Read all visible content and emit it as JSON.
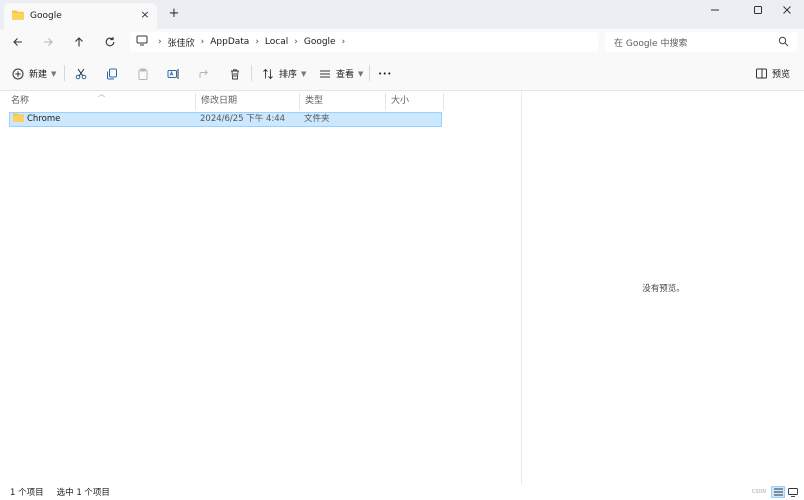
{
  "window": {
    "tab_title": "Google",
    "close_tab_glyph": "×",
    "new_tab_glyph": "+"
  },
  "navigation": {
    "breadcrumbs": [
      "张佳欣",
      "AppData",
      "Local",
      "Google"
    ],
    "separator": "›",
    "search_placeholder": "在 Google 中搜索"
  },
  "toolbar": {
    "new_label": "新建",
    "sort_label": "排序",
    "view_label": "查看",
    "more_glyph": "•••",
    "preview_label": "预览"
  },
  "columns": {
    "name": "名称",
    "date": "修改日期",
    "type": "类型",
    "size": "大小"
  },
  "files": [
    {
      "name": "Chrome",
      "date": "2024/6/25 下午 4:44",
      "type": "文件夹",
      "size": "",
      "selected": true
    }
  ],
  "preview": {
    "empty_text": "没有预览。"
  },
  "status": {
    "item_count": "1 个项目",
    "selection": "选中 1 个项目",
    "watermark": "CSDN"
  },
  "colors": {
    "titlebar_bg": "#ebeef3",
    "toolbar_bg": "#f9f9f9",
    "selection_bg": "#cce8ff",
    "selection_border": "#99d1ff",
    "folder_icon": "#f7c543"
  },
  "icons": [
    "folder-icon",
    "back-arrow-icon",
    "forward-arrow-icon",
    "up-arrow-icon",
    "refresh-icon",
    "computer-icon",
    "search-icon",
    "new-plus-icon",
    "cut-icon",
    "copy-icon",
    "paste-icon",
    "rename-icon",
    "share-icon",
    "delete-icon",
    "sort-icon",
    "view-icon",
    "more-icon",
    "preview-pane-icon",
    "details-view-icon",
    "tiles-view-icon"
  ]
}
